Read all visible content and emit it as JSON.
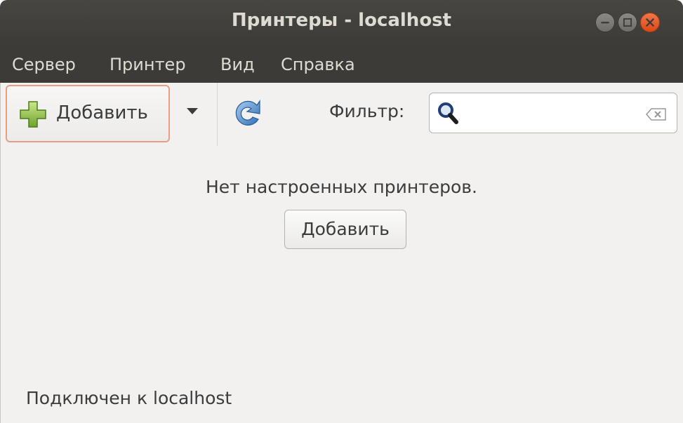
{
  "window": {
    "title": "Принтеры - localhost",
    "controls": [
      "minimize-icon",
      "maximize-icon",
      "close-icon"
    ],
    "accent_close": "#dd4814"
  },
  "menubar": {
    "items": [
      {
        "label": "Сервер"
      },
      {
        "label": "Принтер"
      },
      {
        "label": "Вид"
      },
      {
        "label": "Справка"
      }
    ]
  },
  "toolbar": {
    "add_label": "Добавить",
    "add_icon": "plus-icon",
    "refresh_icon": "refresh-icon",
    "filter_label": "Фильтр:",
    "filter_value": "",
    "filter_placeholder": ""
  },
  "main": {
    "empty_message": "Нет настроенных принтеров.",
    "add_button_label": "Добавить"
  },
  "status": {
    "text": "Подключен к localhost"
  }
}
